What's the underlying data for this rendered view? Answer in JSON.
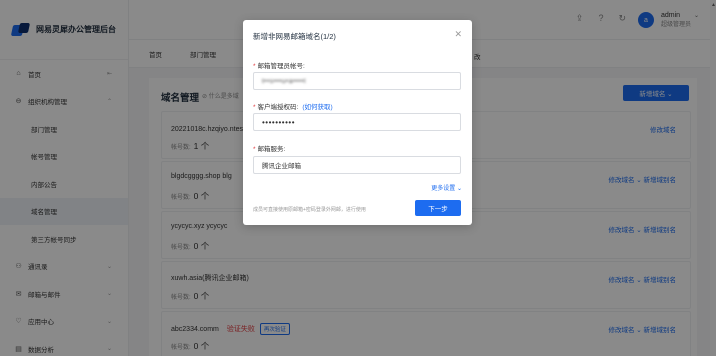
{
  "app": {
    "title": "网易灵犀办公管理后台"
  },
  "sidebar": {
    "items": [
      {
        "label": "首页",
        "icon": "home-icon",
        "glyph": "⌂",
        "type": "group"
      },
      {
        "label": "组织机构管理",
        "icon": "org-icon",
        "glyph": "⊖",
        "type": "group"
      },
      {
        "label": "部门管理",
        "type": "sub"
      },
      {
        "label": "帐号管理",
        "type": "sub"
      },
      {
        "label": "内部公告",
        "type": "sub"
      },
      {
        "label": "域名管理",
        "type": "sub",
        "active": true
      },
      {
        "label": "第三方帐号同步",
        "type": "sub"
      },
      {
        "label": "通讯录",
        "icon": "contacts-icon",
        "glyph": "⚇",
        "type": "group"
      },
      {
        "label": "邮箱与邮件",
        "icon": "mail-icon",
        "glyph": "✉",
        "type": "group"
      },
      {
        "label": "应用中心",
        "icon": "app-center-icon",
        "glyph": "♡",
        "type": "group"
      },
      {
        "label": "数据分析",
        "icon": "analytics-icon",
        "glyph": "▤",
        "type": "group"
      }
    ]
  },
  "header": {
    "user_initial": "a",
    "user_name": "admin",
    "user_role": "超级管理员"
  },
  "tabs": {
    "items": [
      "首页",
      "部门管理",
      "帐号管理"
    ],
    "right_label": "改"
  },
  "main": {
    "title": "域名管理",
    "hint": "⊘ 什么是多域",
    "add_button": "新增域名 ⌄",
    "rows": [
      {
        "domain": "20221018c.hzqiyo.ntes",
        "status": "",
        "badge": "解析",
        "count_label": "帐号数:",
        "count": "1 个",
        "actions": "修改域名"
      },
      {
        "domain": "blgdcgggg.shop  blg",
        "status": "",
        "badge": "",
        "count_label": "帐号数:",
        "count": "0 个",
        "actions": "修改域名 ⌄  新增域别名"
      },
      {
        "domain": "ycycyc.xyz  ycycyc",
        "status": "",
        "badge": "",
        "count_label": "帐号数:",
        "count": "0 个",
        "actions": "修改域名 ⌄  新增域别名"
      },
      {
        "domain": "xuwh.asia(腾讯企业邮箱)",
        "status": "",
        "badge": "",
        "count_label": "帐号数:",
        "count": "0 个",
        "actions": "修改域名 ⌄  新增域别名"
      },
      {
        "domain": "abc2334.comm",
        "status": "验证失败",
        "badge": "再次验证",
        "count_label": "帐号数:",
        "count": "0 个",
        "actions": "修改域名 ⌄  新增域别名"
      }
    ]
  },
  "modal": {
    "title": "新增非网易邮箱域名(1/2)",
    "field1_label": "邮箱管理员帐号:",
    "field1_value": "t••s•••u•a••••l",
    "field2_label": "客户端授权码:",
    "field2_link": "(如何获取)",
    "field2_value": "••••••••••",
    "field3_label": "邮箱服务:",
    "field3_value": "腾讯企业邮箱",
    "more_settings": "更多设置 ⌄",
    "footer_hint": "成员可直接使用原邮箱+密码登录外网邮，进行使用",
    "next_button": "下一步"
  }
}
